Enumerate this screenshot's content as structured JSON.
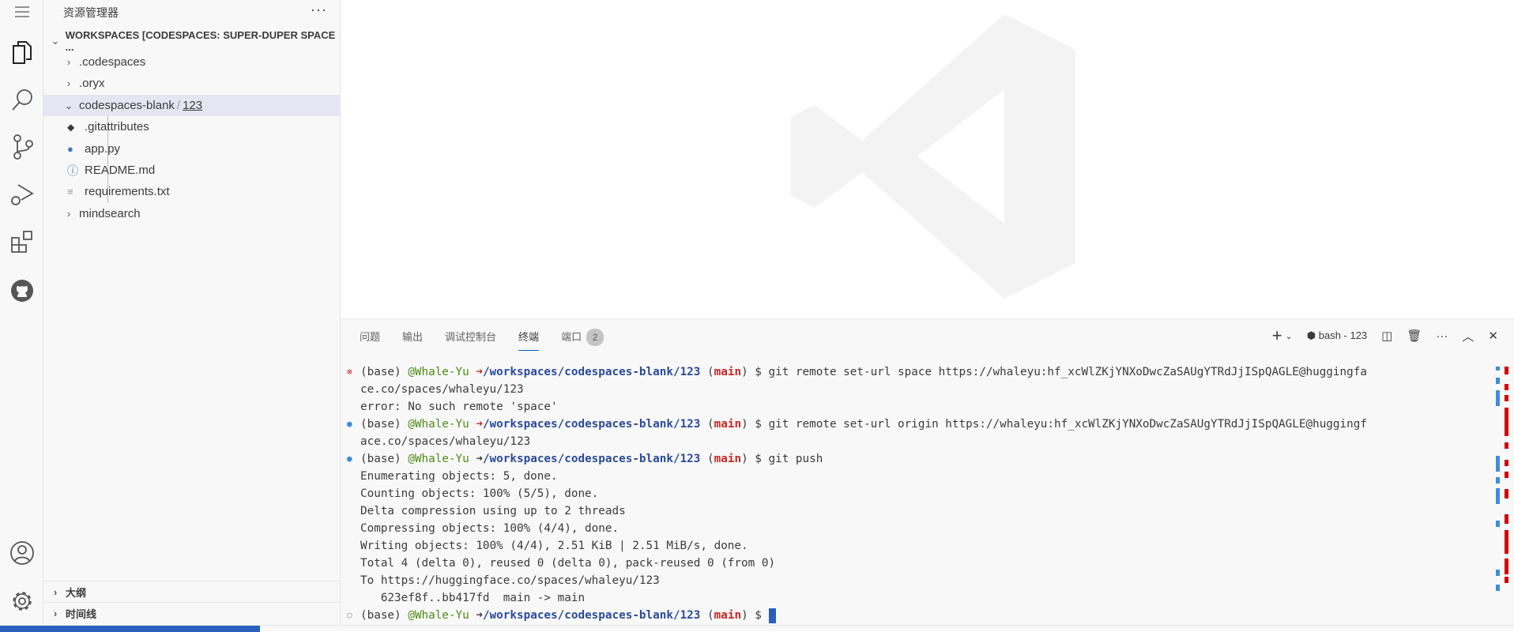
{
  "explorer": {
    "title": "资源管理器",
    "more": "···",
    "workspace": "WORKSPACES [CODESPACES: SUPER-DUPER SPACE ...",
    "items": [
      {
        "label": ".codespaces"
      },
      {
        "label": ".oryx"
      },
      {
        "label": "codespaces-blank",
        "suffix": "123"
      },
      {
        "label": ".gitattributes"
      },
      {
        "label": "app.py"
      },
      {
        "label": "README.md"
      },
      {
        "label": "requirements.txt"
      },
      {
        "label": "mindsearch"
      }
    ],
    "sections": [
      {
        "label": "大纲"
      },
      {
        "label": "时间线"
      }
    ]
  },
  "panel": {
    "tabs": [
      {
        "label": "问题"
      },
      {
        "label": "输出"
      },
      {
        "label": "调试控制台"
      },
      {
        "label": "终端"
      },
      {
        "label": "端口"
      }
    ],
    "ports_badge": "2",
    "terminal_name": "bash - 123"
  },
  "terminal": {
    "prompt": {
      "env": "(base) ",
      "user": "@Whale-Yu ",
      "arrow": "➜",
      "path": "/workspaces/codespaces-blank/123",
      "branch_open": " (",
      "branch": "main",
      "branch_close": ") $ "
    },
    "cmd1": "git remote set-url space https://whaleyu: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@huggingfa",
    "cmd1_cont": "ce.co/spaces/whaleyu/123",
    "err": "error: No such remote 'space'",
    "cmd2": "git remote set-url origin https://whaleyu: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@huggingf",
    "cmd2_cont": "ace.co/spaces/whaleyu/123",
    "cmd3": "git push",
    "output": [
      "Enumerating objects: 5, done.",
      "Counting objects: 100% (5/5), done.",
      "Delta compression using up to 2 threads",
      "Compressing objects: 100% (4/4), done.",
      "Writing objects: 100% (4/4), 2.51 KiB | 2.51 MiB/s, done.",
      "Total 4 (delta 0), reused 0 (delta 0), pack-reused 0 (from 0)",
      "To https://huggingface.co/spaces/whaleyu/123",
      "   623ef8f..bb417fd  main -> main"
    ]
  },
  "colors": {
    "accent": "#005fb8",
    "remote": "#2b5fbd",
    "user": "#4e8a16",
    "path": "#2a4a9a",
    "branch": "#c62828",
    "arrow_err": "#c62828"
  }
}
